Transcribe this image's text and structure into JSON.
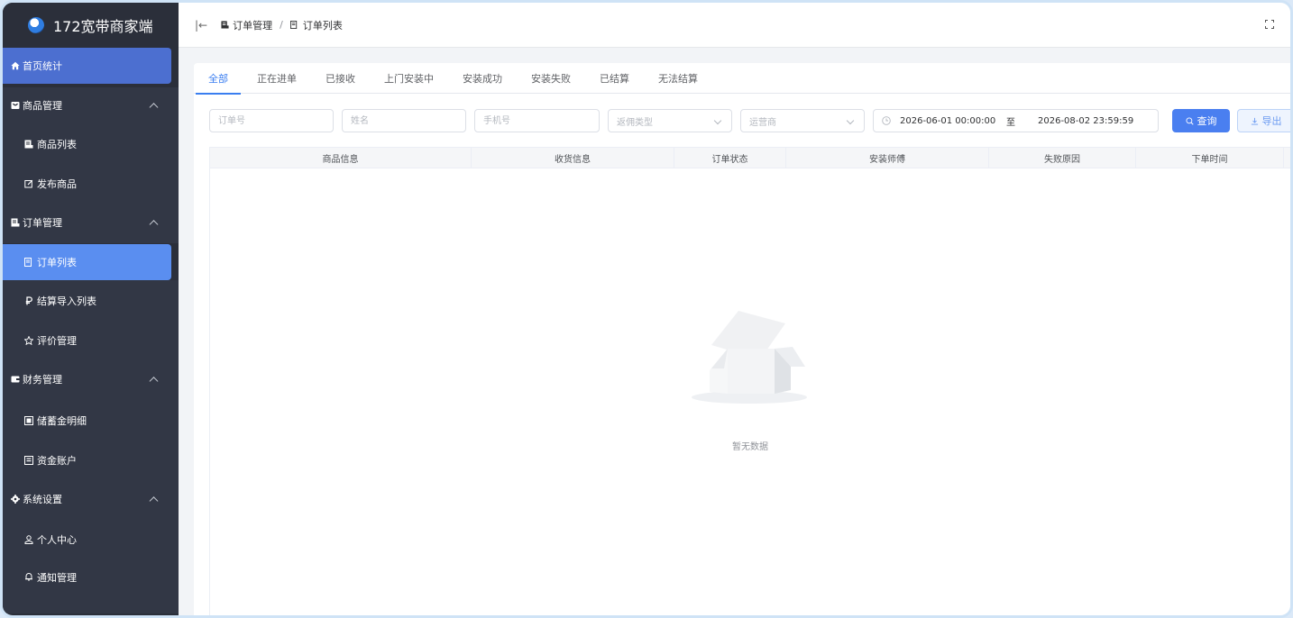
{
  "app": {
    "title": "172宽带商家端"
  },
  "sidebar": {
    "items": [
      {
        "label": "首页统计",
        "icon": "home-icon"
      },
      {
        "label": "商品管理",
        "icon": "shop-icon"
      },
      {
        "label": "商品列表",
        "icon": "list-icon"
      },
      {
        "label": "发布商品",
        "icon": "edit-icon"
      },
      {
        "label": "订单管理",
        "icon": "order-icon"
      },
      {
        "label": "订单列表",
        "icon": "list-icon"
      },
      {
        "label": "结算导入列表",
        "icon": "rouble-icon"
      },
      {
        "label": "评价管理",
        "icon": "star-icon"
      },
      {
        "label": "财务管理",
        "icon": "wallet-icon"
      },
      {
        "label": "储蓄金明细",
        "icon": "ledger-icon"
      },
      {
        "label": "资金账户",
        "icon": "account-icon"
      },
      {
        "label": "系统设置",
        "icon": "gear-icon"
      },
      {
        "label": "个人中心",
        "icon": "user-icon"
      },
      {
        "label": "通知管理",
        "icon": "bell-icon"
      }
    ]
  },
  "header": {
    "breadcrumb": [
      "订单管理",
      "订单列表"
    ],
    "separator": "/"
  },
  "tabs": [
    "全部",
    "正在进单",
    "已接收",
    "上门安装中",
    "安装成功",
    "安装失败",
    "已结算",
    "无法结算"
  ],
  "filters": {
    "order_no_placeholder": "订单号",
    "name_placeholder": "姓名",
    "phone_placeholder": "手机号",
    "commission_type_placeholder": "返佣类型",
    "operator_placeholder": "运营商",
    "date_start": "2026-06-01 00:00:00",
    "date_sep": "至",
    "date_end": "2026-08-02 23:59:59",
    "query_label": "查询",
    "export_label": "导出"
  },
  "table": {
    "columns": [
      "商品信息",
      "收货信息",
      "订单状态",
      "安装师傅",
      "失败原因",
      "下单时间"
    ],
    "empty_text": "暂无数据"
  },
  "colors": {
    "accent": "#3a7ef0",
    "sidebar_bg": "#2b2f3a",
    "active_item": "#5a8ef0"
  }
}
